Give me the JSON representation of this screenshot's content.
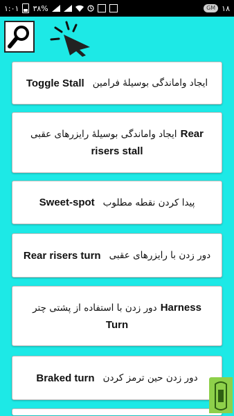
{
  "status_bar": {
    "time": "۱۸",
    "left_text": "۱:۰۱",
    "battery_percent": "۳۸%",
    "avatar": "GM"
  },
  "toolbar": {
    "search_icon": "search-icon",
    "pointer_icon": "cursor-click-icon"
  },
  "items": [
    {
      "fa": "ایجاد واماندگی بوسیلهٔ فرامین",
      "en": "Toggle Stall"
    },
    {
      "fa": "ایجاد واماندگی بوسیلهٔ رایزرهای عقبی",
      "en": "Rear risers stall"
    },
    {
      "fa": "پیدا کردن نقطه مطلوب",
      "en": "Sweet-spot"
    },
    {
      "fa": "دور زدن با رایزرهای عقبی",
      "en": "Rear risers turn"
    },
    {
      "fa": "دور زدن با استفاده از پشتی چتر",
      "en": "Harness Turn"
    },
    {
      "fa": "دور زدن حین ترمز کردن",
      "en": "Braked turn"
    }
  ],
  "colors": {
    "background": "#1de9e6",
    "card": "#ffffff",
    "badge": "#8ed04a"
  }
}
